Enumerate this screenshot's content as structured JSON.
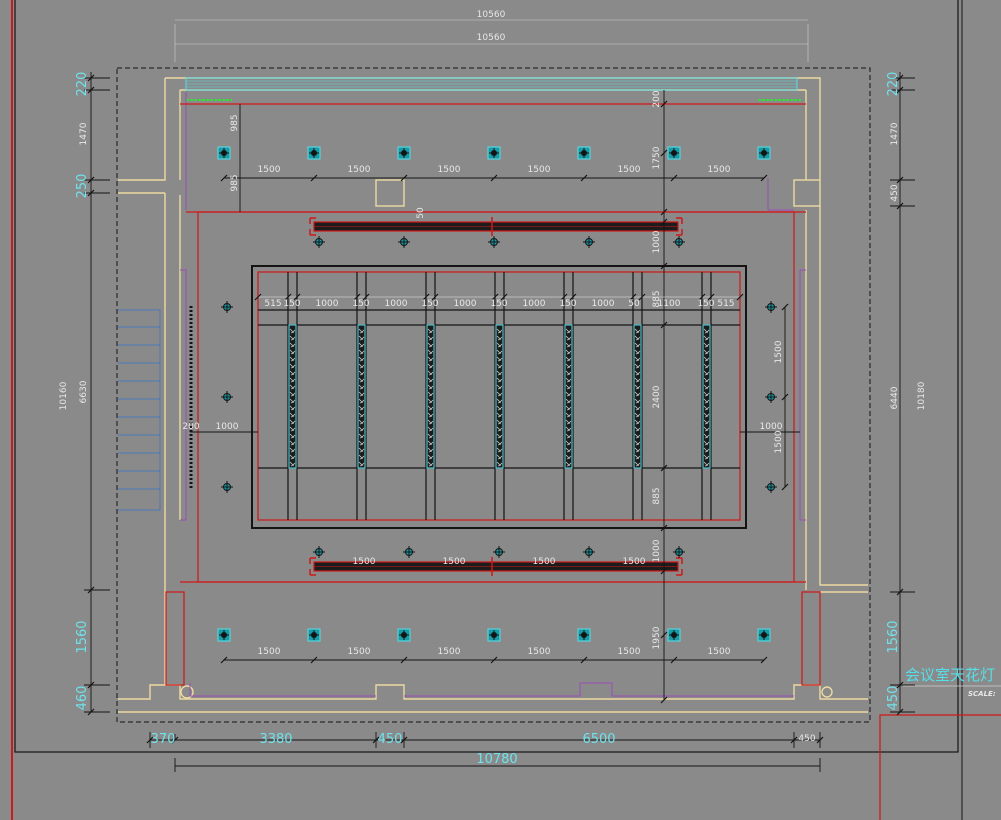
{
  "drawing": {
    "title": "会议室天花灯",
    "scale_label": "SCALE:",
    "colors": {
      "background": "#8a8a8a",
      "wall": "#ecd9a0",
      "red": "#d01818",
      "cyan": "#55dfe8",
      "purple": "#9a4fb6",
      "black": "#141414",
      "blue": "#4a78b8",
      "white": "#e8e8e8"
    }
  },
  "dims": {
    "top_outer": "10560",
    "top_inner": "10560",
    "left_220": "220",
    "left_1470": "1470",
    "left_250": "250",
    "left_6630": "6630",
    "left_10160": "10160",
    "left_1560": "1560",
    "left_460": "460",
    "right_220": "220",
    "right_1470": "1470",
    "right_450": "450",
    "right_6440": "6440",
    "right_10180": "10180",
    "right_1560": "1560",
    "right_450b": "450",
    "bottom_370": "370",
    "bottom_3380": "3380",
    "bottom_450": "450",
    "bottom_6500": "6500",
    "bottom_450b": "450",
    "bottom_total": "10780",
    "d985a": "985",
    "d985b": "985",
    "d200": "200",
    "d1750": "1750",
    "d1000a": "1000",
    "d885a": "885",
    "d2400": "2400",
    "d885b": "885",
    "d1000b": "1000",
    "d1950": "1950",
    "d50a": "50",
    "d1500_right_a": "1500",
    "d1500_right_b": "1500",
    "d1000_left": "1000",
    "d200_left": "200",
    "d1000_right": "1000",
    "top_spacing": [
      "1500",
      "1500",
      "1500",
      "1500",
      "1500",
      "1500"
    ],
    "bottom_spacing": [
      "1500",
      "1500",
      "1500",
      "1500",
      "1500",
      "1500"
    ],
    "strip_spacing": [
      "1500",
      "1500",
      "1500",
      "1500"
    ],
    "panel_row": [
      "515",
      "150",
      "1000",
      "150",
      "1000",
      "150",
      "1000",
      "150",
      "1000",
      "150",
      "1000",
      "50",
      "1100",
      "150",
      "515"
    ]
  }
}
